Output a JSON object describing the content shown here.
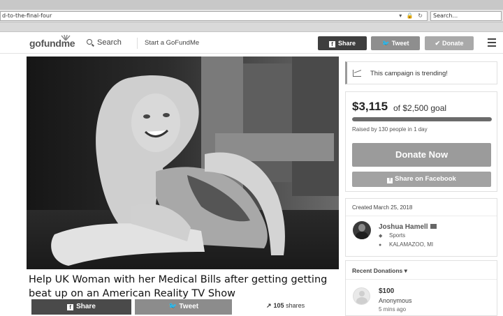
{
  "browser": {
    "url": "d-to-the-final-four",
    "search_placeholder": "Search..."
  },
  "header": {
    "logo": "gofundme",
    "search_label": "Search",
    "start_label": "Start a GoFundMe",
    "share_label": "Share",
    "tweet_label": "Tweet",
    "donate_label": "Donate"
  },
  "campaign": {
    "title": "Help UK Woman with her Medical Bills after getting getting beat up on an American Reality TV Show",
    "share_button": "Share",
    "tweet_button": "Tweet",
    "share_count": "105",
    "share_count_suffix": "shares"
  },
  "sidebar": {
    "trending_text": "This campaign is trending!",
    "amount_raised": "$3,115",
    "goal_text": "of $2,500 goal",
    "progress_percent": 100,
    "raised_by": "Raised by 130 people in 1 day",
    "donate_now_label": "Donate Now",
    "share_facebook_label": "Share on Facebook",
    "created": "Created March 25, 2018",
    "organizer_name": "Joshua Hamell",
    "category": "Sports",
    "location": "KALAMAZOO, MI",
    "recent_donations_label": "Recent Donations",
    "donation_amount": "$100",
    "donation_name": "Anonymous",
    "donation_time": "5 mins ago"
  },
  "colors": {
    "page_bg": "#ffffff",
    "share_button_bg": "#3e3e3e",
    "tweet_button_bg": "#8e8e8e",
    "donate_button_bg": "#9b9b9b",
    "progress_fill": "#6b6b6b"
  },
  "icons": [
    "lock-icon",
    "search-icon",
    "facebook-icon",
    "twitter-icon",
    "check-icon",
    "menu-icon",
    "trending-chart-icon",
    "mail-icon",
    "tag-icon",
    "location-pin-icon",
    "chevron-down-icon",
    "trending-arrow-icon"
  ]
}
